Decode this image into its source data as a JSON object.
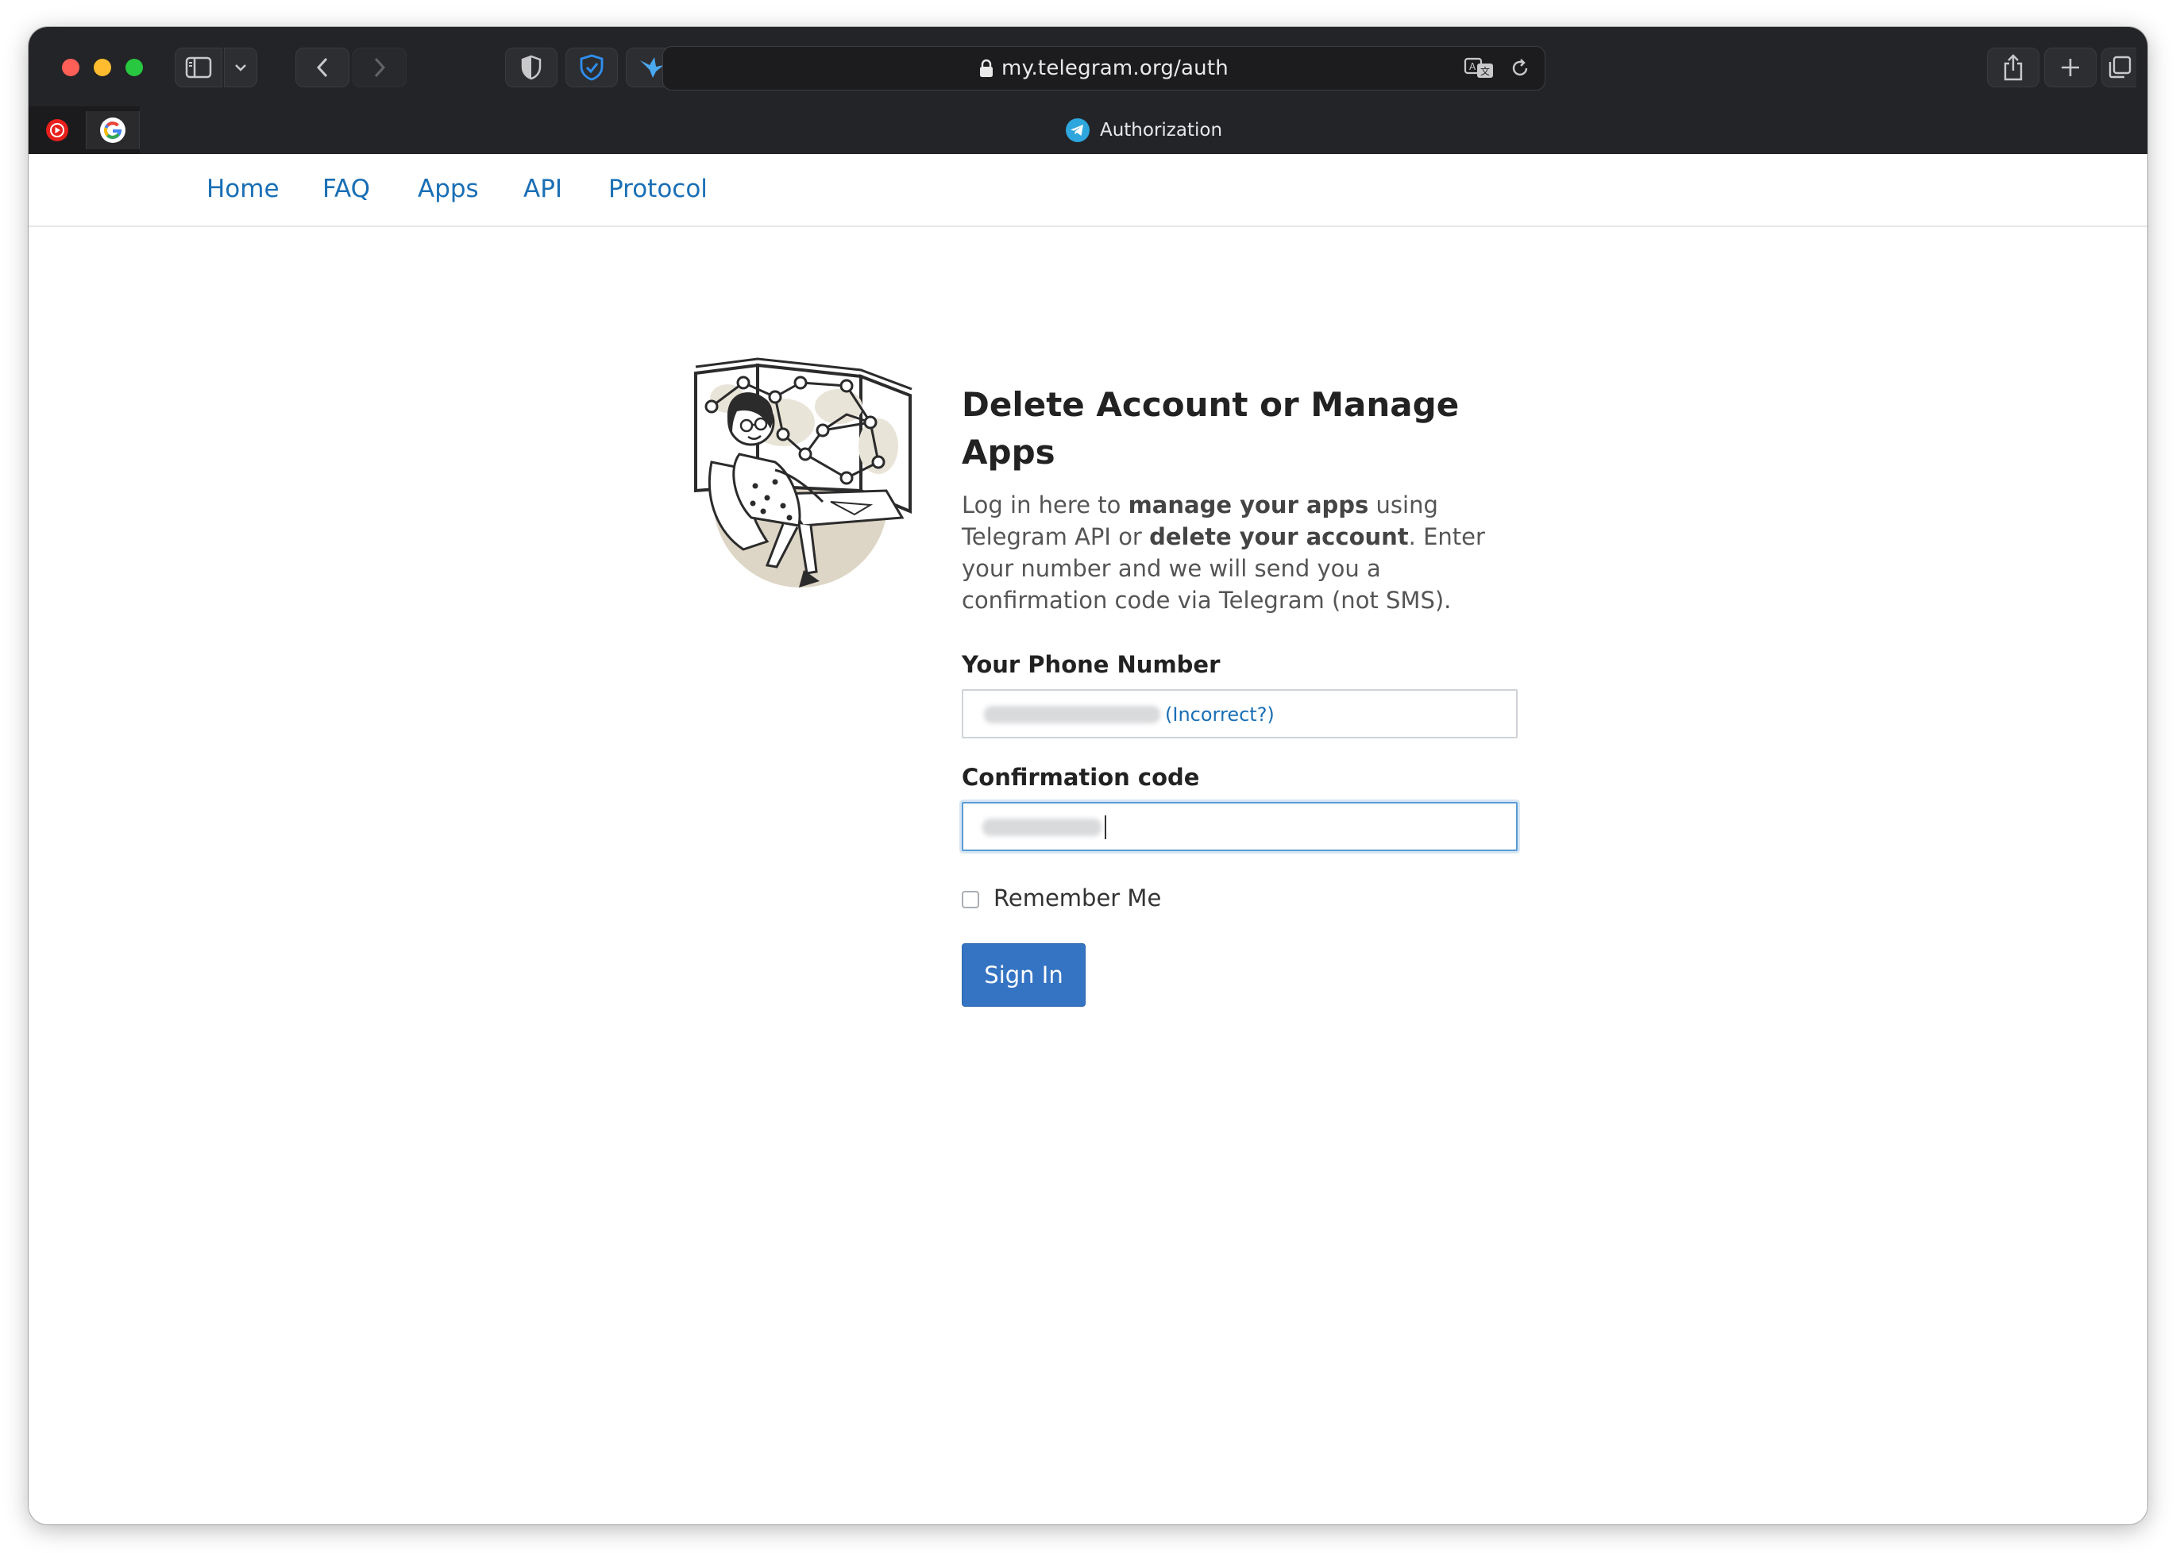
{
  "browser": {
    "address_url": "my.telegram.org/auth",
    "tab_title": "Authorization",
    "pinned_tabs": [
      {
        "name": "youtube-music",
        "icon": "youtube-music-icon"
      },
      {
        "name": "google",
        "icon": "google-icon"
      }
    ]
  },
  "nav": {
    "items": [
      "Home",
      "FAQ",
      "Apps",
      "API",
      "Protocol"
    ]
  },
  "main": {
    "title": "Delete Account or Manage Apps",
    "desc_parts": [
      "Log in here to ",
      "manage your apps",
      " using Telegram API or ",
      "delete your account",
      ". Enter your number and we will send you a confirmation code via Telegram (not SMS)."
    ],
    "phone_label": "Your Phone Number",
    "incorrect_link": "(Incorrect?)",
    "code_label": "Confirmation code",
    "remember_label": "Remember Me",
    "signin_label": "Sign In"
  },
  "colors": {
    "link": "#1a6fb5",
    "button": "#3574c3",
    "chrome": "#232427"
  }
}
